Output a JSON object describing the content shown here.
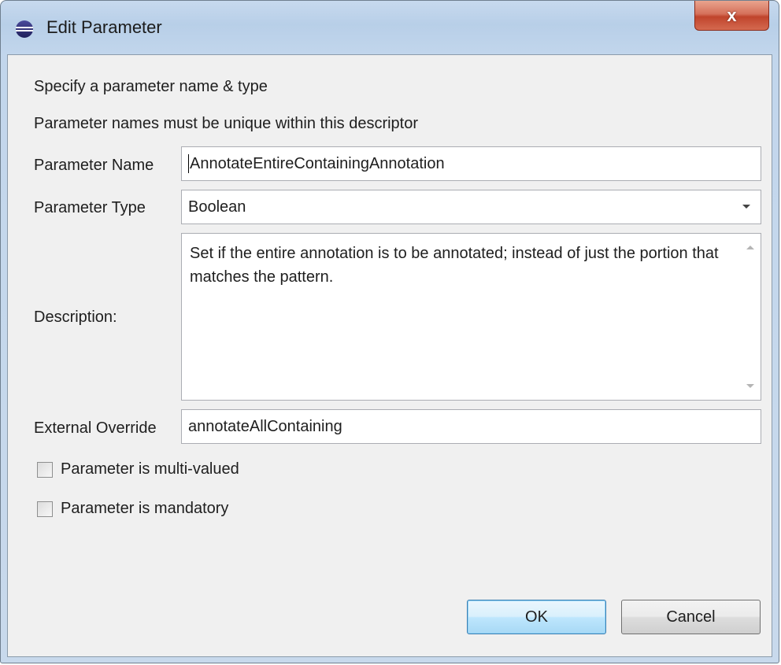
{
  "window": {
    "title": "Edit Parameter",
    "close_label": "x"
  },
  "intro": {
    "line1": "Specify a parameter name & type",
    "line2": "Parameter names must be unique within this descriptor"
  },
  "form": {
    "name_label": "Parameter Name",
    "name_value": "AnnotateEntireContainingAnnotation",
    "type_label": "Parameter Type",
    "type_value": "Boolean",
    "description_label": "Description:",
    "description_value": "Set if the entire annotation is to be annotated; instead of just the portion that matches the pattern.",
    "override_label": "External Override",
    "override_value": "annotateAllContaining"
  },
  "options": {
    "multi_valued": {
      "label": "Parameter is multi-valued",
      "checked": false
    },
    "mandatory": {
      "label": "Parameter is mandatory",
      "checked": false
    }
  },
  "buttons": {
    "ok": "OK",
    "cancel": "Cancel"
  },
  "icons": {
    "app": "eclipse-icon",
    "close": "close-icon",
    "dropdown": "chevron-down-icon",
    "scroll_up": "scroll-up-icon",
    "scroll_down": "scroll-down-icon"
  },
  "colors": {
    "dialog_bg": "#f0f0f0",
    "close_button": "#c7452c",
    "default_button_border": "#3c7fb1"
  }
}
